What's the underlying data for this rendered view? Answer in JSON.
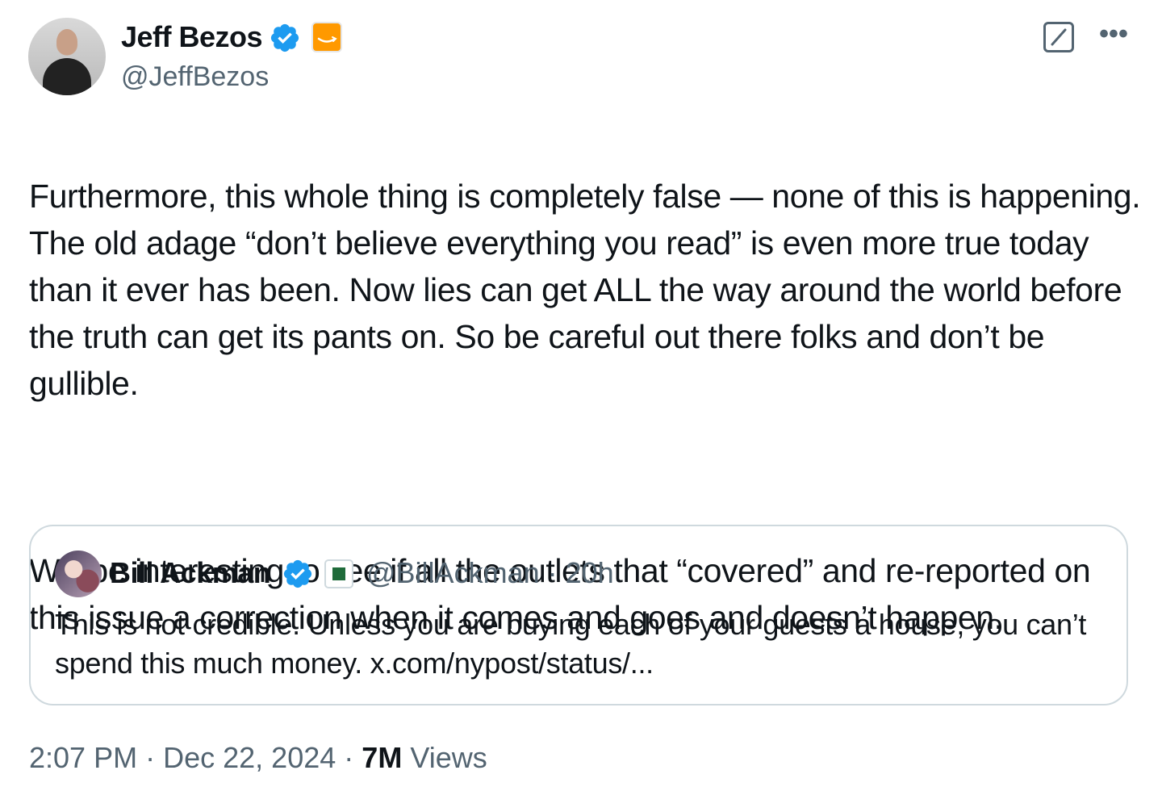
{
  "author": {
    "name": "Jeff Bezos",
    "handle": "@JeffBezos",
    "avatar_icon": "avatar-jeff-bezos",
    "verified_color": "#1d9bf0",
    "affiliate_color": "#ff9900"
  },
  "tweet": {
    "paragraph_1": "Furthermore, this whole thing is completely false — none of this is happening. The old adage “don’t believe everything you read” is even more true today than it ever has been. Now lies can get ALL the way around the world before the truth can get its pants on. So be careful out there folks and don’t be gullible.",
    "paragraph_2": "Will be interesting to see if all the outlets that “covered” and re-reported on this issue a correction when it comes and goes and doesn’t happen."
  },
  "quote": {
    "name": "Bill Ackman",
    "handle": "@BillAckman",
    "separator": "·",
    "time": "20h",
    "text": "This is not credible. Unless you are buying each of your guests a house, you can’t spend this much money. x.com/nypost/status/..."
  },
  "footer": {
    "time": "2:07 PM",
    "date": "Dec 22, 2024",
    "views_count": "7M",
    "views_label": "Views",
    "separator": "·"
  },
  "icons": {
    "grok": "grok-icon",
    "more": "more-icon",
    "verified": "verified-badge-icon"
  }
}
